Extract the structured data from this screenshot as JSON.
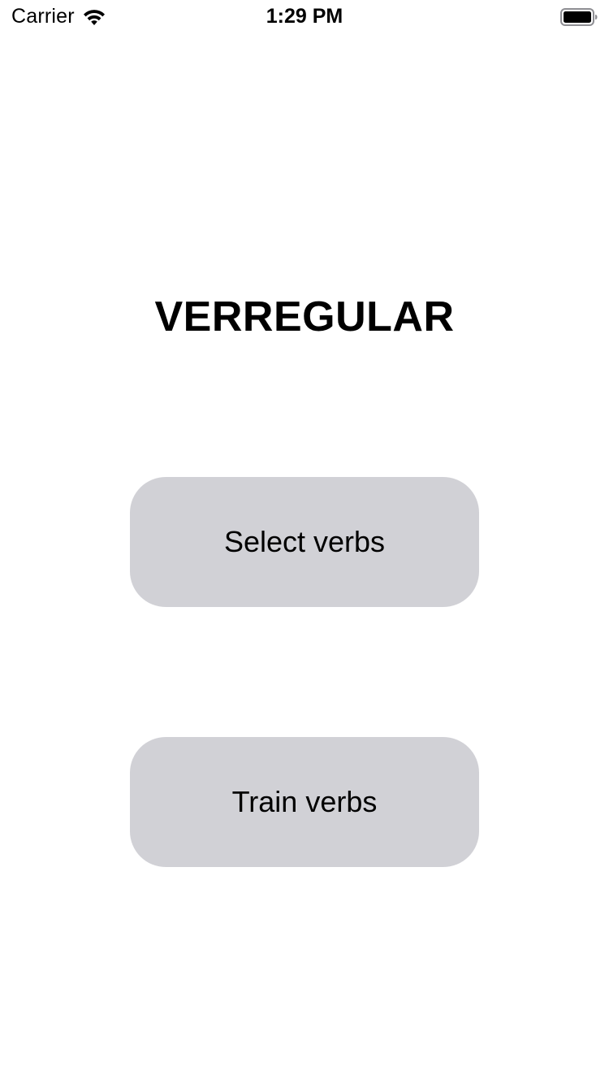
{
  "status_bar": {
    "carrier": "Carrier",
    "time": "1:29 PM",
    "wifi_icon": "wifi-icon",
    "battery_icon": "battery-icon"
  },
  "main": {
    "title": "VERREGULAR",
    "buttons": [
      {
        "label": "Select verbs"
      },
      {
        "label": "Train verbs"
      }
    ]
  },
  "colors": {
    "background": "#ffffff",
    "button_fill": "#d1d1d6",
    "text": "#000000"
  }
}
